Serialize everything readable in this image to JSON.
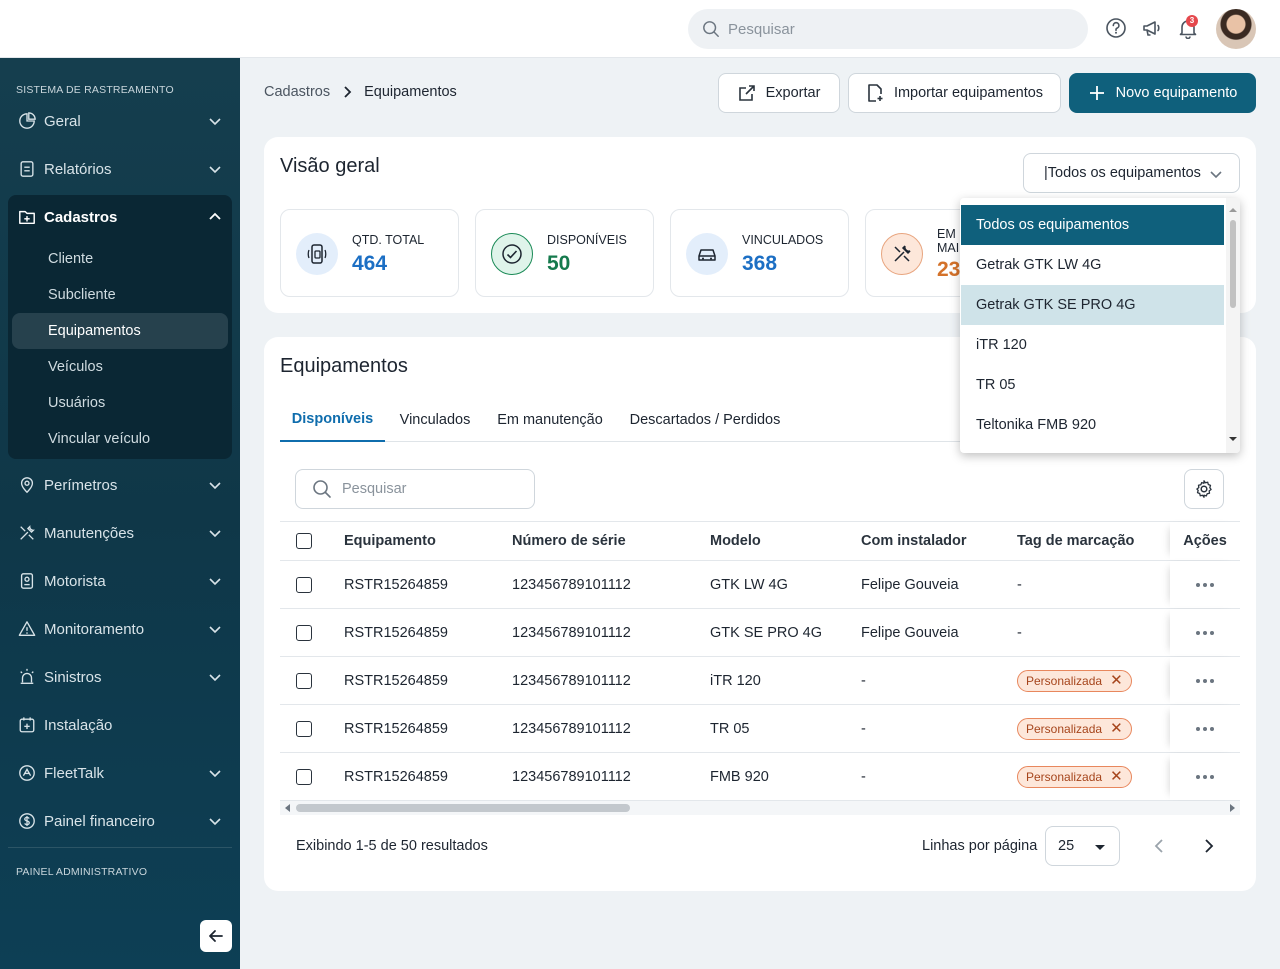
{
  "topbar": {
    "search_placeholder": "Pesquisar",
    "notification_count": "3"
  },
  "sidebar": {
    "section_tracking": "SISTEMA DE RASTREAMENTO",
    "section_admin": "PAINEL ADMINISTRATIVO",
    "items": [
      {
        "label": "Geral",
        "icon": "pie-chart-icon"
      },
      {
        "label": "Relatórios",
        "icon": "document-icon"
      },
      {
        "label": "Cadastros",
        "icon": "folder-plus-icon"
      },
      {
        "label": "Perímetros",
        "icon": "map-pin-icon"
      },
      {
        "label": "Manutenções",
        "icon": "tools-icon"
      },
      {
        "label": "Motorista",
        "icon": "id-badge-icon"
      },
      {
        "label": "Monitoramento",
        "icon": "warning-icon"
      },
      {
        "label": "Sinistros",
        "icon": "siren-icon"
      },
      {
        "label": "Instalação",
        "icon": "calendar-plus-icon"
      },
      {
        "label": "FleetTalk",
        "icon": "fleettalk-icon"
      },
      {
        "label": "Painel financeiro",
        "icon": "dollar-icon"
      }
    ],
    "subitems": [
      "Cliente",
      "Subcliente",
      "Equipamentos",
      "Veículos",
      "Usuários",
      "Vincular veículo"
    ]
  },
  "breadcrumb": {
    "parent": "Cadastros",
    "current": "Equipamentos"
  },
  "actions": {
    "export_label": "Exportar",
    "import_label": "Importar equipamentos",
    "new_label": "Novo equipamento"
  },
  "overview": {
    "title": "Visão geral",
    "filter_value": "|Todos os equipamentos",
    "stats": [
      {
        "label": "QTD. TOTAL",
        "value": "464",
        "color": "#1c6fc4"
      },
      {
        "label": "DISPONÍVEIS",
        "value": "50",
        "color": "#157a4d"
      },
      {
        "label": "VINCULADOS",
        "value": "368",
        "color": "#1c6fc4"
      },
      {
        "label_line1": "EM",
        "label_line2": "MAI",
        "value": "23",
        "color": "#d4722a"
      }
    ]
  },
  "dropdown": {
    "options": [
      "Todos os equipamentos",
      "Getrak GTK LW 4G",
      "Getrak GTK SE PRO 4G",
      "iTR 120",
      "TR 05",
      "Teltonika FMB 920"
    ]
  },
  "equipment": {
    "title": "Equipamentos",
    "tabs": [
      "Disponíveis",
      "Vinculados",
      "Em manutenção",
      "Descartados / Perdidos"
    ],
    "search_placeholder": "Pesquisar",
    "columns": [
      "Equipamento",
      "Número de série",
      "Modelo",
      "Com instalador",
      "Tag de marcação",
      "Ações"
    ],
    "rows": [
      {
        "equipment": "RSTR15264859",
        "serial": "123456789101112",
        "model": "GTK LW 4G",
        "installer": "Felipe Gouveia",
        "tag": "-"
      },
      {
        "equipment": "RSTR15264859",
        "serial": "123456789101112",
        "model": "GTK SE PRO 4G",
        "installer": "Felipe Gouveia",
        "tag": "-"
      },
      {
        "equipment": "RSTR15264859",
        "serial": "123456789101112",
        "model": "iTR 120",
        "installer": "-",
        "tag": "Personalizada"
      },
      {
        "equipment": "RSTR15264859",
        "serial": "123456789101112",
        "model": "TR 05",
        "installer": "-",
        "tag": "Personalizada"
      },
      {
        "equipment": "RSTR15264859",
        "serial": "123456789101112",
        "model": "FMB 920",
        "installer": "-",
        "tag": "Personalizada"
      }
    ],
    "footer": {
      "showing": "Exibindo 1-5 de 50 resultados",
      "rows_per_page_label": "Linhas por página",
      "rows_per_page_value": "25"
    }
  }
}
